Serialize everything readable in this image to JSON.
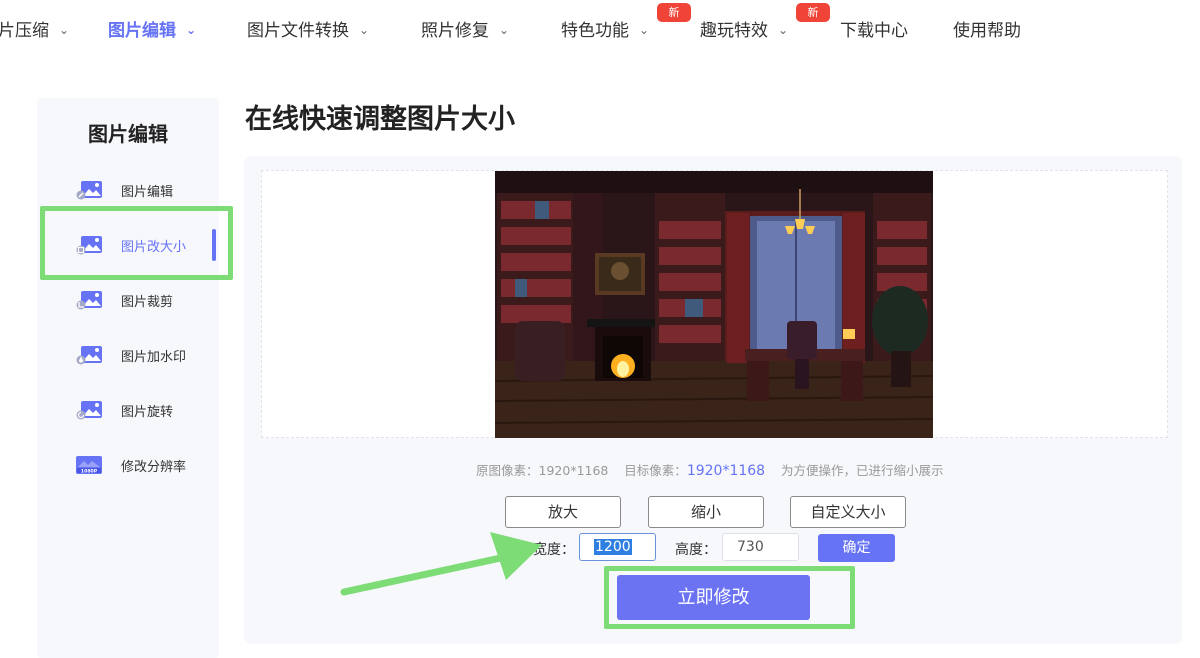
{
  "nav": {
    "items": [
      {
        "label": "片压缩",
        "chevron": true
      },
      {
        "label": "图片编辑",
        "chevron": true,
        "active": true
      },
      {
        "label": "图片文件转换",
        "chevron": true
      },
      {
        "label": "照片修复",
        "chevron": true
      },
      {
        "label": "特色功能",
        "chevron": true,
        "badge": "新"
      },
      {
        "label": "趣玩特效",
        "chevron": true,
        "badge": "新"
      },
      {
        "label": "下载中心",
        "chevron": false
      },
      {
        "label": "使用帮助",
        "chevron": false
      }
    ]
  },
  "sidebar": {
    "title": "图片编辑",
    "items": [
      {
        "label": "图片编辑",
        "icon": "image-edit-icon"
      },
      {
        "label": "图片改大小",
        "icon": "image-resize-icon",
        "active": true
      },
      {
        "label": "图片裁剪",
        "icon": "image-crop-icon"
      },
      {
        "label": "图片加水印",
        "icon": "image-watermark-icon"
      },
      {
        "label": "图片旋转",
        "icon": "image-rotate-icon"
      },
      {
        "label": "修改分辨率",
        "icon": "resolution-1080p-icon",
        "icon_text": "1080P"
      }
    ]
  },
  "main": {
    "title": "在线快速调整图片大小",
    "info": {
      "original_label": "原图像素：",
      "original_value": "1920*1168",
      "target_label": "目标像素：",
      "target_value": "1920*1168",
      "note": "为方便操作，已进行缩小展示"
    },
    "buttons": {
      "enlarge": "放大",
      "shrink": "缩小",
      "custom": "自定义大小",
      "confirm": "确定",
      "apply": "立即修改"
    },
    "width_label": "宽度：",
    "width_value": "1200",
    "height_label": "高度：",
    "height_value": "730"
  },
  "colors": {
    "accent": "#6673f5",
    "annotation_green": "#7ddc76",
    "badge_red": "#f04438"
  }
}
